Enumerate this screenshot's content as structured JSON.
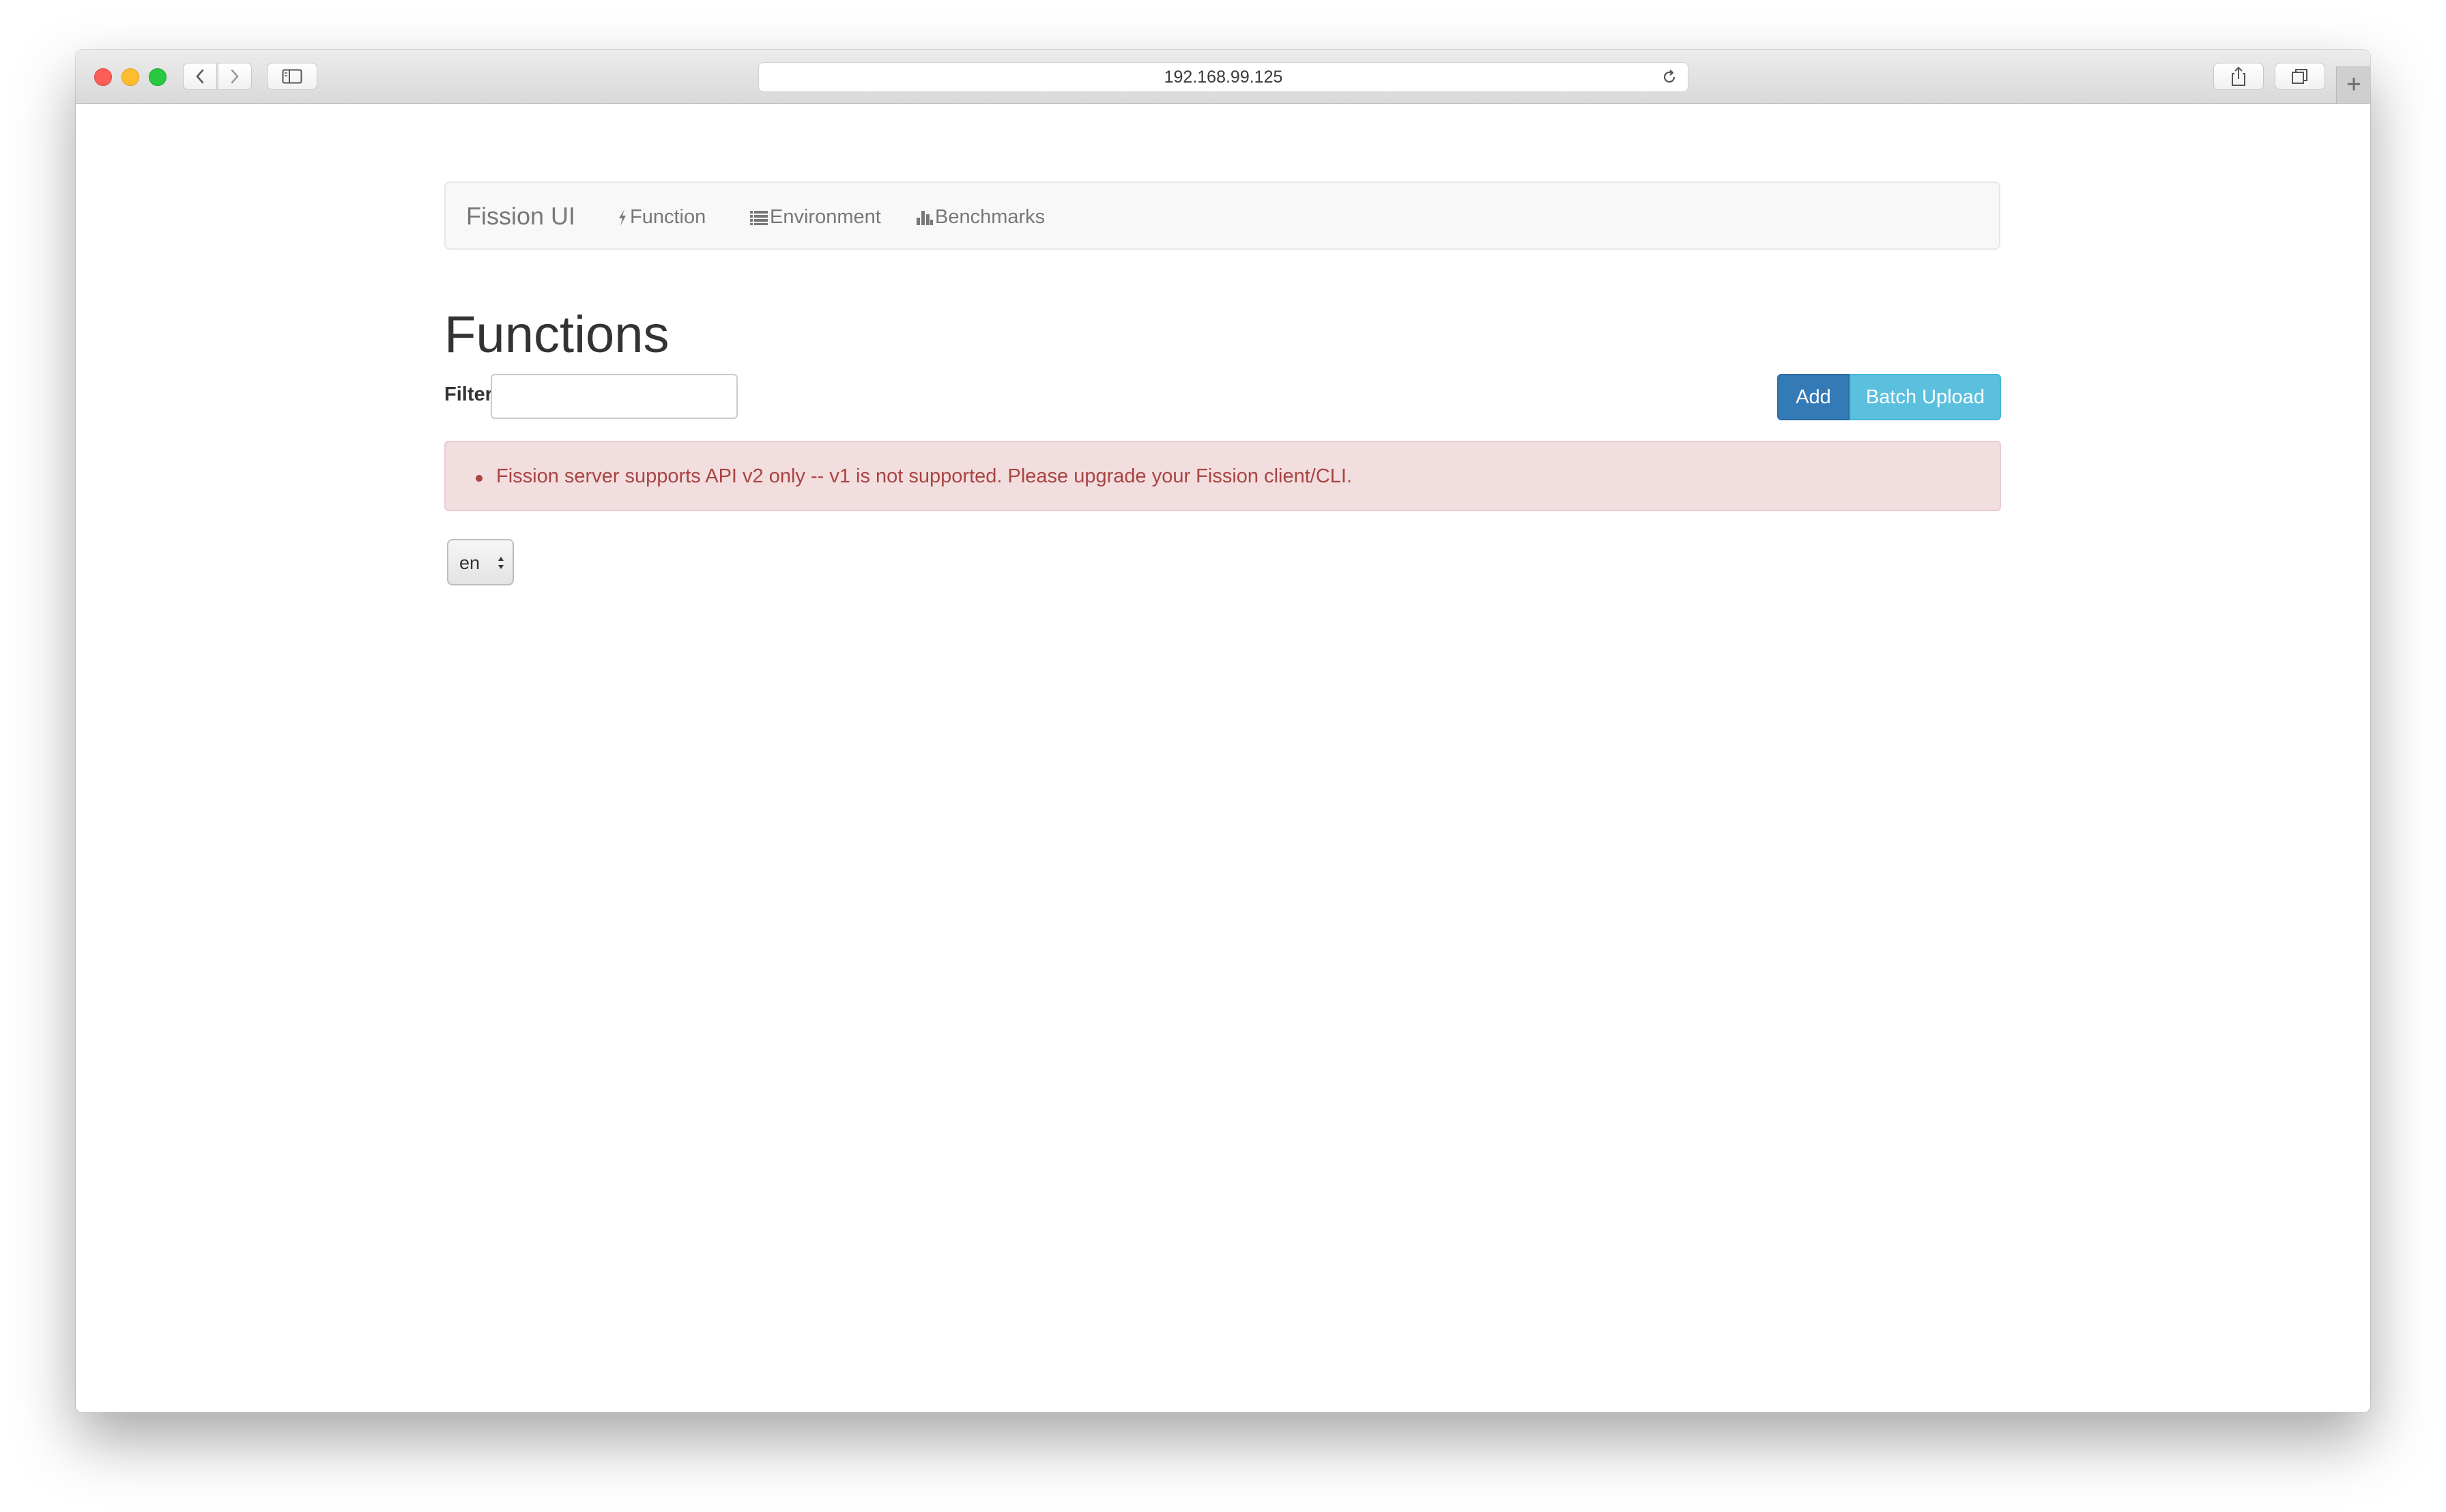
{
  "browser": {
    "url": "192.168.99.125",
    "new_tab_symbol": "+"
  },
  "navbar": {
    "brand": "Fission UI",
    "items": [
      {
        "label": "Function",
        "icon": "flash-icon"
      },
      {
        "label": "Environment",
        "icon": "list-icon"
      },
      {
        "label": "Benchmarks",
        "icon": "bar-chart-icon"
      }
    ]
  },
  "main": {
    "title": "Functions",
    "filter_label": "Filter",
    "filter_value": "",
    "add_label": "Add",
    "batch_upload_label": "Batch Upload",
    "errors": [
      "Fission server supports API v2 only -- v1 is not supported. Please upgrade your Fission client/CLI."
    ],
    "language_selected": "en"
  },
  "colors": {
    "primary": "#337ab7",
    "info": "#5bc0de",
    "danger_bg": "#f2dede",
    "danger_text": "#a94442"
  }
}
